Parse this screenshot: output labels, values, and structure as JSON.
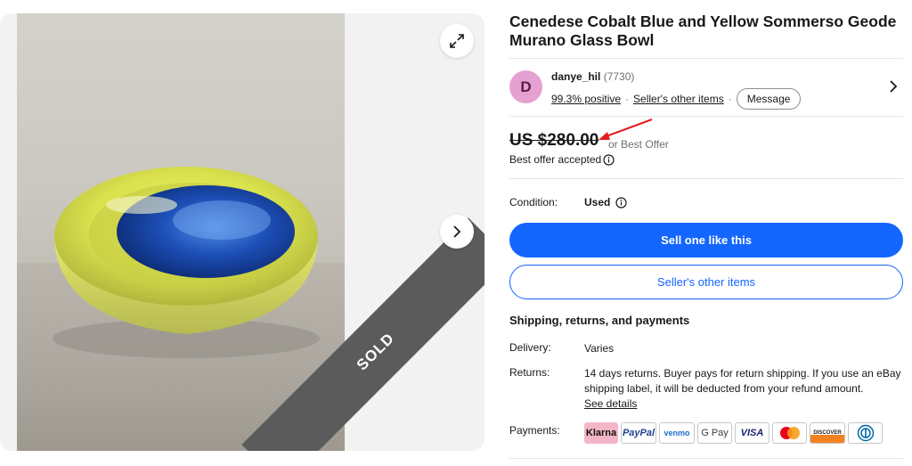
{
  "gallery": {
    "sold_label": "SOLD",
    "expand_icon": "expand-icon",
    "next_icon": "chevron-right-icon"
  },
  "listing": {
    "title": "Cenedese Cobalt Blue and Yellow Sommerso Geode Murano Glass Bowl"
  },
  "seller": {
    "avatar_letter": "D",
    "name": "danye_hil",
    "feedback_count": "(7730)",
    "positive": "99.3% positive",
    "other_items_link": "Seller's other items",
    "message_label": "Message"
  },
  "price": {
    "amount": "US $280.00",
    "offer_text": "or Best Offer",
    "accepted_text": "Best offer accepted"
  },
  "condition": {
    "label": "Condition:",
    "value": "Used"
  },
  "actions": {
    "primary": "Sell one like this",
    "secondary": "Seller's other items"
  },
  "shipping": {
    "heading": "Shipping, returns, and payments",
    "delivery_label": "Delivery:",
    "delivery_value": "Varies",
    "returns_label": "Returns:",
    "returns_value": "14 days returns. Buyer pays for return shipping. If you use an eBay shipping label, it will be deducted from your refund amount.",
    "see_details": "See details",
    "payments_label": "Payments:",
    "methods": [
      "Klarna",
      "PayPal",
      "venmo",
      "G Pay",
      "VISA",
      "",
      "DISCOVER",
      ""
    ]
  },
  "colors": {
    "accent": "#1466ff",
    "sold_band": "#5b5b5b",
    "avatar_bg": "#e5a1d1",
    "annotation_arrow": "#e02020"
  }
}
